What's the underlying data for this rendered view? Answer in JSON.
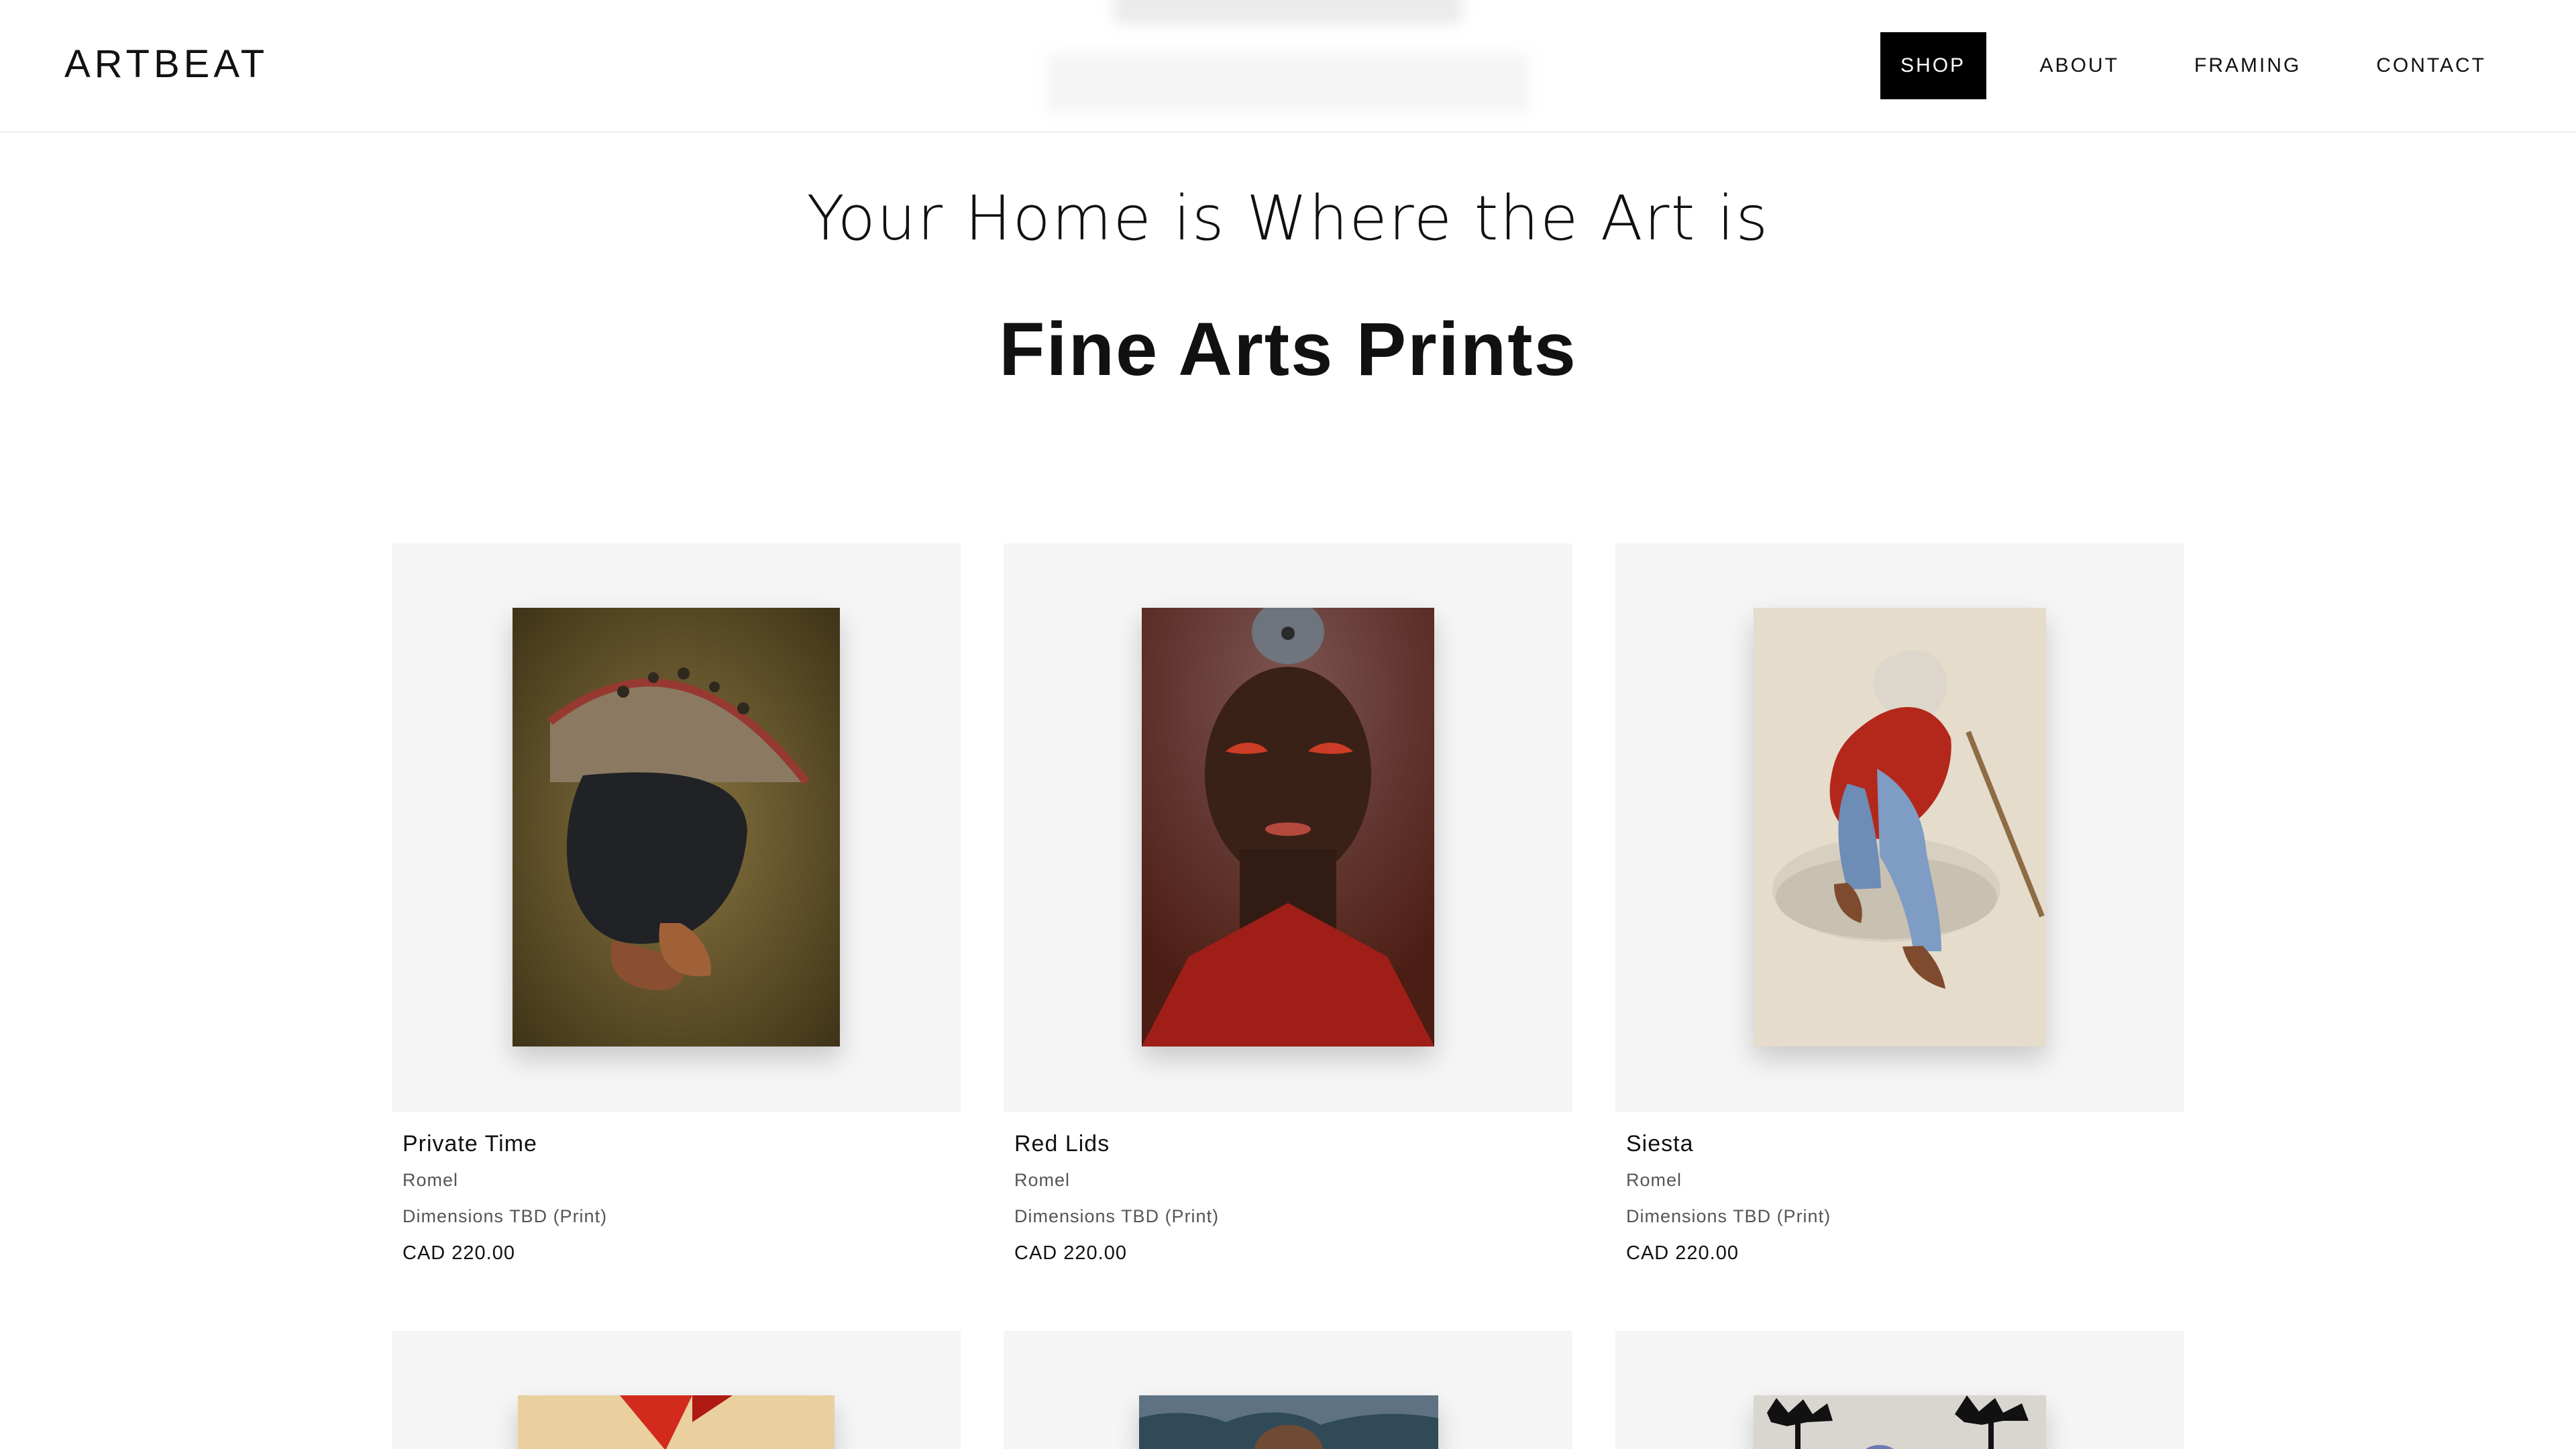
{
  "brand": {
    "logo": "ARTBEAT"
  },
  "nav": {
    "items": [
      {
        "label": "SHOP",
        "active": true
      },
      {
        "label": "ABOUT",
        "active": false
      },
      {
        "label": "FRAMING",
        "active": false
      },
      {
        "label": "CONTACT",
        "active": false
      }
    ]
  },
  "hero": {
    "subtitle": "Your Home is Where the Art is",
    "title": "Fine Arts Prints"
  },
  "products": [
    {
      "name": "Private Time",
      "artist": "Romel",
      "dimensions": "Dimensions TBD (Print)",
      "price": "CAD 220.00"
    },
    {
      "name": "Red Lids",
      "artist": "Romel",
      "dimensions": "Dimensions TBD (Print)",
      "price": "CAD 220.00"
    },
    {
      "name": "Siesta",
      "artist": "Romel",
      "dimensions": "Dimensions TBD (Print)",
      "price": "CAD 220.00"
    }
  ],
  "colors": {
    "accent": "#000000",
    "background": "#ffffff",
    "card_background": "#f5f5f5"
  }
}
